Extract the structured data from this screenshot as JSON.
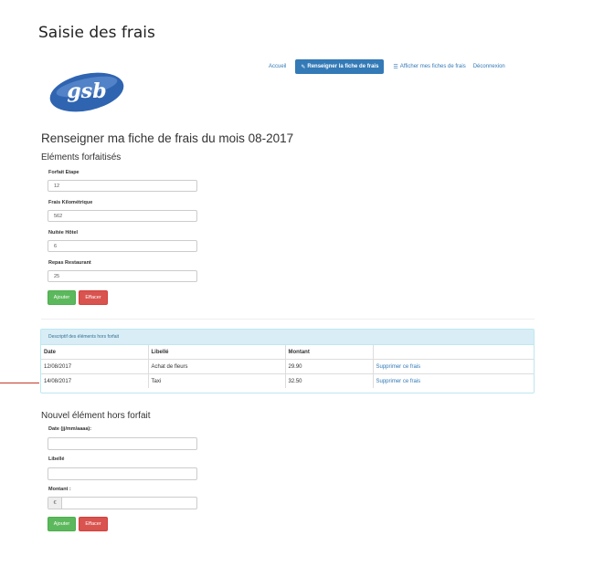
{
  "window": {
    "title": "Saisie des frais"
  },
  "nav": {
    "items": [
      {
        "label": "Accueil",
        "icon": ""
      },
      {
        "label": "Renseigner la fiche de frais",
        "icon": "pencil-icon"
      },
      {
        "label": "Afficher mes fiches de frais",
        "icon": "list-icon"
      },
      {
        "label": "Déconnexion",
        "icon": ""
      }
    ],
    "active_index": 1
  },
  "logo": {
    "text": "gsb"
  },
  "page_heading": "Renseigner ma fiche de frais du mois 08-2017",
  "forfait": {
    "title": "Eléments forfaitisés",
    "fields": [
      {
        "label": "Forfait Etape",
        "value": "12"
      },
      {
        "label": "Frais Kilométrique",
        "value": "562"
      },
      {
        "label": "Nuitée Hôtel",
        "value": "6"
      },
      {
        "label": "Repas Restaurant",
        "value": "25"
      }
    ],
    "add_label": "Ajouter",
    "reset_label": "Effacer"
  },
  "hors_forfait_table": {
    "heading": "Descriptif des éléments hors forfait",
    "columns": [
      "Date",
      "Libellé",
      "Montant",
      ""
    ],
    "rows": [
      {
        "date": "12/08/2017",
        "libelle": "Achat de fleurs",
        "montant": "29.90",
        "action": "Supprimer ce frais"
      },
      {
        "date": "14/08/2017",
        "libelle": "Taxi",
        "montant": "32.50",
        "action": "Supprimer ce frais"
      }
    ]
  },
  "nouvel_element": {
    "title": "Nouvel élément hors forfait",
    "date_label": "Date (jj/mm/aaaa):",
    "date_value": "",
    "libelle_label": "Libellé",
    "libelle_value": "",
    "montant_label": "Montant :",
    "currency_symbol": "€",
    "montant_value": "",
    "add_label": "Ajouter",
    "reset_label": "Effacer"
  },
  "colors": {
    "primary": "#337ab7",
    "success": "#5cb85c",
    "danger": "#d9534f",
    "panel_info": "#d9edf7"
  }
}
